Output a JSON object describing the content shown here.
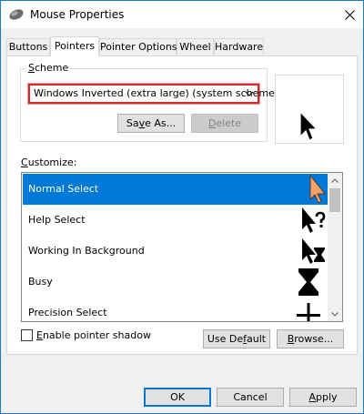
{
  "window": {
    "title": "Mouse Properties"
  },
  "tabs": [
    {
      "label": "Buttons",
      "active": false
    },
    {
      "label": "Pointers",
      "active": true
    },
    {
      "label": "Pointer Options",
      "active": false
    },
    {
      "label": "Wheel",
      "active": false
    },
    {
      "label": "Hardware",
      "active": false
    }
  ],
  "scheme": {
    "group_label_first": "S",
    "group_label_rest": "cheme",
    "selected": "Windows Inverted (extra large) (system scheme)",
    "save_as_first": "Sa",
    "save_as_u": "v",
    "save_as_rest": "e As...",
    "delete_first": "",
    "delete_u": "D",
    "delete_rest": "elete"
  },
  "customize": {
    "label_u": "C",
    "label_rest": "ustomize:",
    "items": [
      {
        "label": "Normal Select",
        "cursor_icon": "arrow-cursor-icon",
        "selected": true
      },
      {
        "label": "Help Select",
        "cursor_icon": "help-cursor-icon",
        "selected": false
      },
      {
        "label": "Working In Background",
        "cursor_icon": "working-cursor-icon",
        "selected": false
      },
      {
        "label": "Busy",
        "cursor_icon": "hourglass-cursor-icon",
        "selected": false
      },
      {
        "label": "Precision Select",
        "cursor_icon": "crosshair-cursor-icon",
        "selected": false
      }
    ]
  },
  "shadow": {
    "label_u": "E",
    "label_rest": "nable pointer shadow",
    "checked": false
  },
  "buttons": {
    "use_default_first": "Use De",
    "use_default_u": "f",
    "use_default_rest": "ault",
    "browse_u": "B",
    "browse_rest": "rowse...",
    "ok": "OK",
    "cancel": "Cancel",
    "apply_u": "A",
    "apply_rest": "pply"
  },
  "colors": {
    "accent": "#0078d7",
    "highlight_border": "#d12b2b",
    "selected_cursor": "#f5a36a"
  }
}
